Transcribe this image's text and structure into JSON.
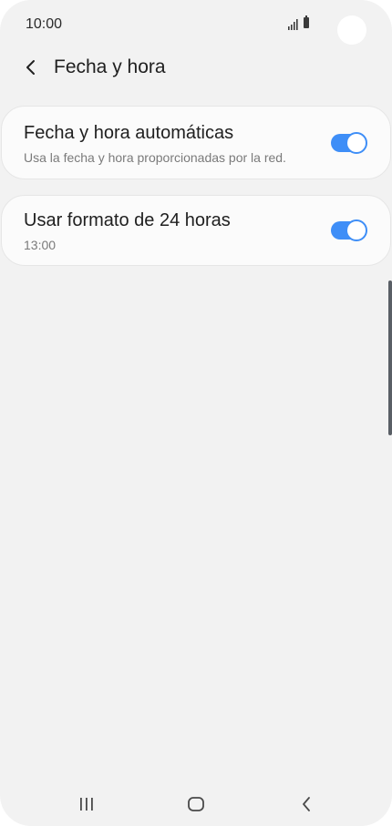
{
  "status_bar": {
    "time": "10:00",
    "icons": [
      "signal-icon",
      "battery-icon"
    ]
  },
  "header": {
    "back_icon": "chevron-left-icon",
    "title": "Fecha y hora"
  },
  "settings": [
    {
      "title": "Fecha y hora automáticas",
      "subtitle": "Usa la fecha y hora proporcionadas por la red.",
      "enabled": true
    },
    {
      "title": "Usar formato de 24 horas",
      "subtitle": "13:00",
      "enabled": true
    }
  ],
  "nav_bar": {
    "icons": [
      "recents-icon",
      "home-icon",
      "back-icon"
    ]
  },
  "colors": {
    "background": "#f2f2f2",
    "card": "#fbfbfb",
    "accent": "#3e8ef7"
  }
}
